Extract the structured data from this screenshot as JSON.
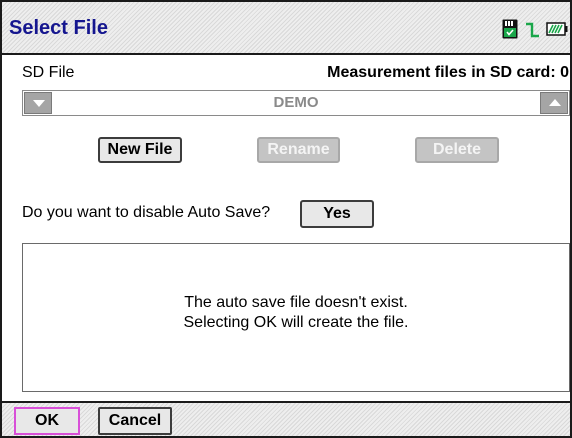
{
  "header": {
    "title": "Select File",
    "icons": [
      "sd-card-icon",
      "signal-icon",
      "battery-icon"
    ]
  },
  "file_section": {
    "sd_label": "SD File",
    "count_label": "Measurement files in SD card: 0",
    "selected_file": "DEMO"
  },
  "file_actions": {
    "new_label": "New File",
    "rename_label": "Rename",
    "delete_label": "Delete"
  },
  "autosave": {
    "question": "Do you want to disable Auto Save?",
    "yes_label": "Yes"
  },
  "message": {
    "line1": "The auto save file doesn't exist.",
    "line2": "Selecting OK will create the file."
  },
  "footer": {
    "ok_label": "OK",
    "cancel_label": "Cancel"
  },
  "colors": {
    "title": "#15168f",
    "focus_border": "#d84fd8",
    "disabled_button": "#c4c4c4"
  }
}
